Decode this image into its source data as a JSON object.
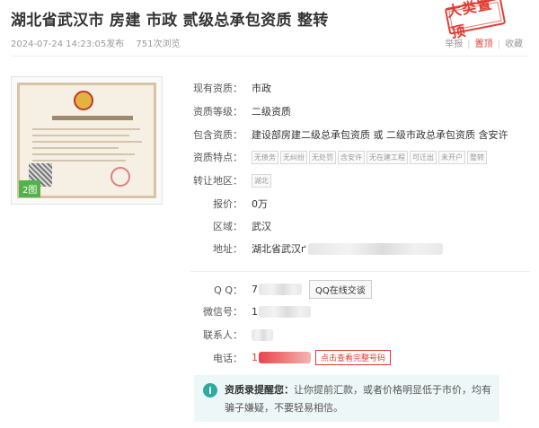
{
  "title": "湖北省武汉市 房建 市政 贰级总承包资质 整转",
  "meta": {
    "published": "2024-07-24 14:23:05发布",
    "views": "751次浏览"
  },
  "stamp": "大类置顶",
  "actions": {
    "report": "举报",
    "pin": "置顶",
    "favorite": "收藏"
  },
  "image": {
    "count_badge": "2图"
  },
  "details": [
    {
      "label": "现有资质：",
      "value": "市政"
    },
    {
      "label": "资质等级：",
      "value": "二级资质"
    },
    {
      "label": "包含资质：",
      "value": "建设部房建二级总承包资质 或 二级市政总承包资质 含安许"
    },
    {
      "label": "资质特点："
    },
    {
      "label": "转让地区："
    },
    {
      "label": "报价：",
      "value": "0万"
    },
    {
      "label": "区域：",
      "value": "武汉"
    },
    {
      "label": "地址：",
      "value": "湖北省武汉ґ"
    }
  ],
  "features": [
    "无债务",
    "无纠纷",
    "无处罚",
    "含安许",
    "无在建工程",
    "可迁出",
    "未开户",
    "整转"
  ],
  "region_tag": "湖北",
  "contact": {
    "qq_label": "Q Q：",
    "qq_prefix": "7",
    "qq_button": "QQ在线交谈",
    "wechat_label": "微信号：",
    "wechat_prefix": "1",
    "person_label": "联系人：",
    "phone_label": "电话：",
    "phone_prefix": "1",
    "phone_button": "点击查看完整号码"
  },
  "notice": {
    "heading": "资质录提醒您：",
    "text": "让你提前汇款，或者价格明显低于市价，均有骗子嫌疑，不要轻易相信。"
  }
}
